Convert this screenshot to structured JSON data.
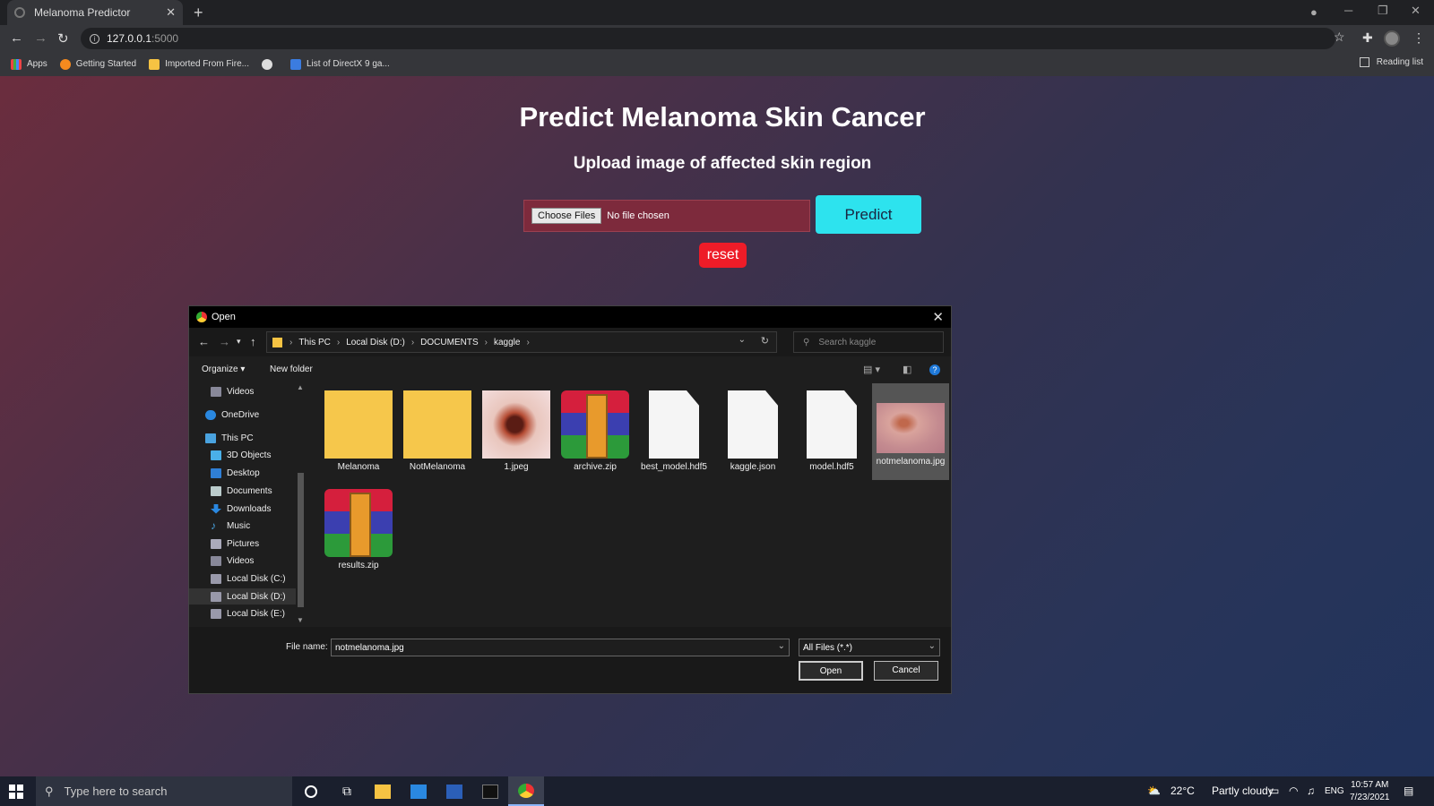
{
  "browser": {
    "tab_title": "Melanoma Predictor",
    "url_host": "127.0.0.1",
    "url_port": ":5000",
    "bookmarks": [
      "Apps",
      "Getting Started",
      "Imported From Fire...",
      "",
      "List of DirectX 9 ga..."
    ],
    "reading_list": "Reading list"
  },
  "page": {
    "title": "Predict Melanoma Skin Cancer",
    "subtitle": "Upload image of affected skin region",
    "choose_files": "Choose Files",
    "no_file": "No file chosen",
    "predict": "Predict",
    "reset": "reset",
    "colors": {
      "predict": "#2de3ee",
      "reset": "#ee1c28",
      "filebox": "#7d2a3c"
    }
  },
  "dialog": {
    "title": "Open",
    "breadcrumb": [
      "This PC",
      "Local Disk (D:)",
      "DOCUMENTS",
      "kaggle"
    ],
    "search_placeholder": "Search kaggle",
    "organize": "Organize",
    "new_folder": "New folder",
    "nav": [
      "Videos",
      "OneDrive",
      "This PC",
      "3D Objects",
      "Desktop",
      "Documents",
      "Downloads",
      "Music",
      "Pictures",
      "Videos",
      "Local Disk (C:)",
      "Local Disk (D:)",
      "Local Disk (E:)"
    ],
    "files": [
      {
        "name": "Melanoma",
        "kind": "folder"
      },
      {
        "name": "NotMelanoma",
        "kind": "folder"
      },
      {
        "name": "1.jpeg",
        "kind": "image"
      },
      {
        "name": "archive.zip",
        "kind": "zip"
      },
      {
        "name": "best_model.hdf5",
        "kind": "file"
      },
      {
        "name": "kaggle.json",
        "kind": "file"
      },
      {
        "name": "model.hdf5",
        "kind": "file"
      },
      {
        "name": "notmelanoma.jpg",
        "kind": "image",
        "selected": true
      },
      {
        "name": "results.zip",
        "kind": "zip"
      }
    ],
    "file_name_label": "File name:",
    "file_name_value": "notmelanoma.jpg",
    "file_type": "All Files (*.*)",
    "open": "Open",
    "cancel": "Cancel"
  },
  "taskbar": {
    "search_placeholder": "Type here to search",
    "temperature": "22°C",
    "weather": "Partly cloudy",
    "language": "ENG",
    "time": "10:57 AM",
    "date": "7/23/2021"
  }
}
